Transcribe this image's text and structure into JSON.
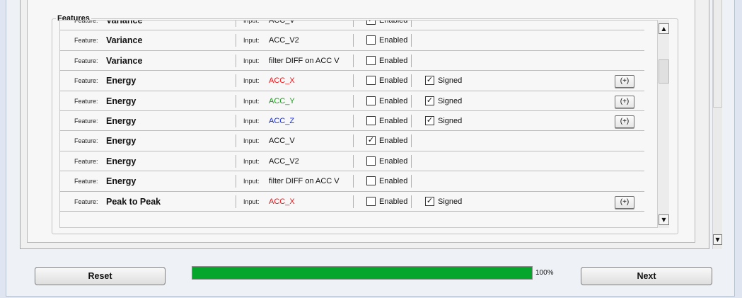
{
  "features_group": {
    "title": "Features",
    "feature_label": "Feature:",
    "input_label": "Input:",
    "enabled_label": "Enabled",
    "signed_label": "Signed",
    "plus_label": "(+)",
    "rows": [
      {
        "name": "Variance",
        "input": "ACC_V",
        "input_color": "#111111",
        "enabled": true,
        "signed": null
      },
      {
        "name": "Variance",
        "input": "ACC_V2",
        "input_color": "#111111",
        "enabled": false,
        "signed": null
      },
      {
        "name": "Variance",
        "input": "filter DIFF on ACC V",
        "input_color": "#111111",
        "enabled": false,
        "signed": null
      },
      {
        "name": "Energy",
        "input": "ACC_X",
        "input_color": "#e8161a",
        "enabled": false,
        "signed": true
      },
      {
        "name": "Energy",
        "input": "ACC_Y",
        "input_color": "#1a9a1a",
        "enabled": false,
        "signed": true
      },
      {
        "name": "Energy",
        "input": "ACC_Z",
        "input_color": "#1a2fe0",
        "enabled": false,
        "signed": true
      },
      {
        "name": "Energy",
        "input": "ACC_V",
        "input_color": "#111111",
        "enabled": true,
        "signed": null
      },
      {
        "name": "Energy",
        "input": "ACC_V2",
        "input_color": "#111111",
        "enabled": false,
        "signed": null
      },
      {
        "name": "Energy",
        "input": "filter DIFF on ACC V",
        "input_color": "#111111",
        "enabled": false,
        "signed": null
      },
      {
        "name": "Peak to Peak",
        "input": "ACC_X",
        "input_color": "#e8161a",
        "enabled": false,
        "signed": true
      }
    ]
  },
  "bottom_bar": {
    "reset_label": "Reset",
    "next_label": "Next",
    "progress_value": 1.0,
    "progress_text": "100%",
    "progress_color": "#06a62c"
  }
}
